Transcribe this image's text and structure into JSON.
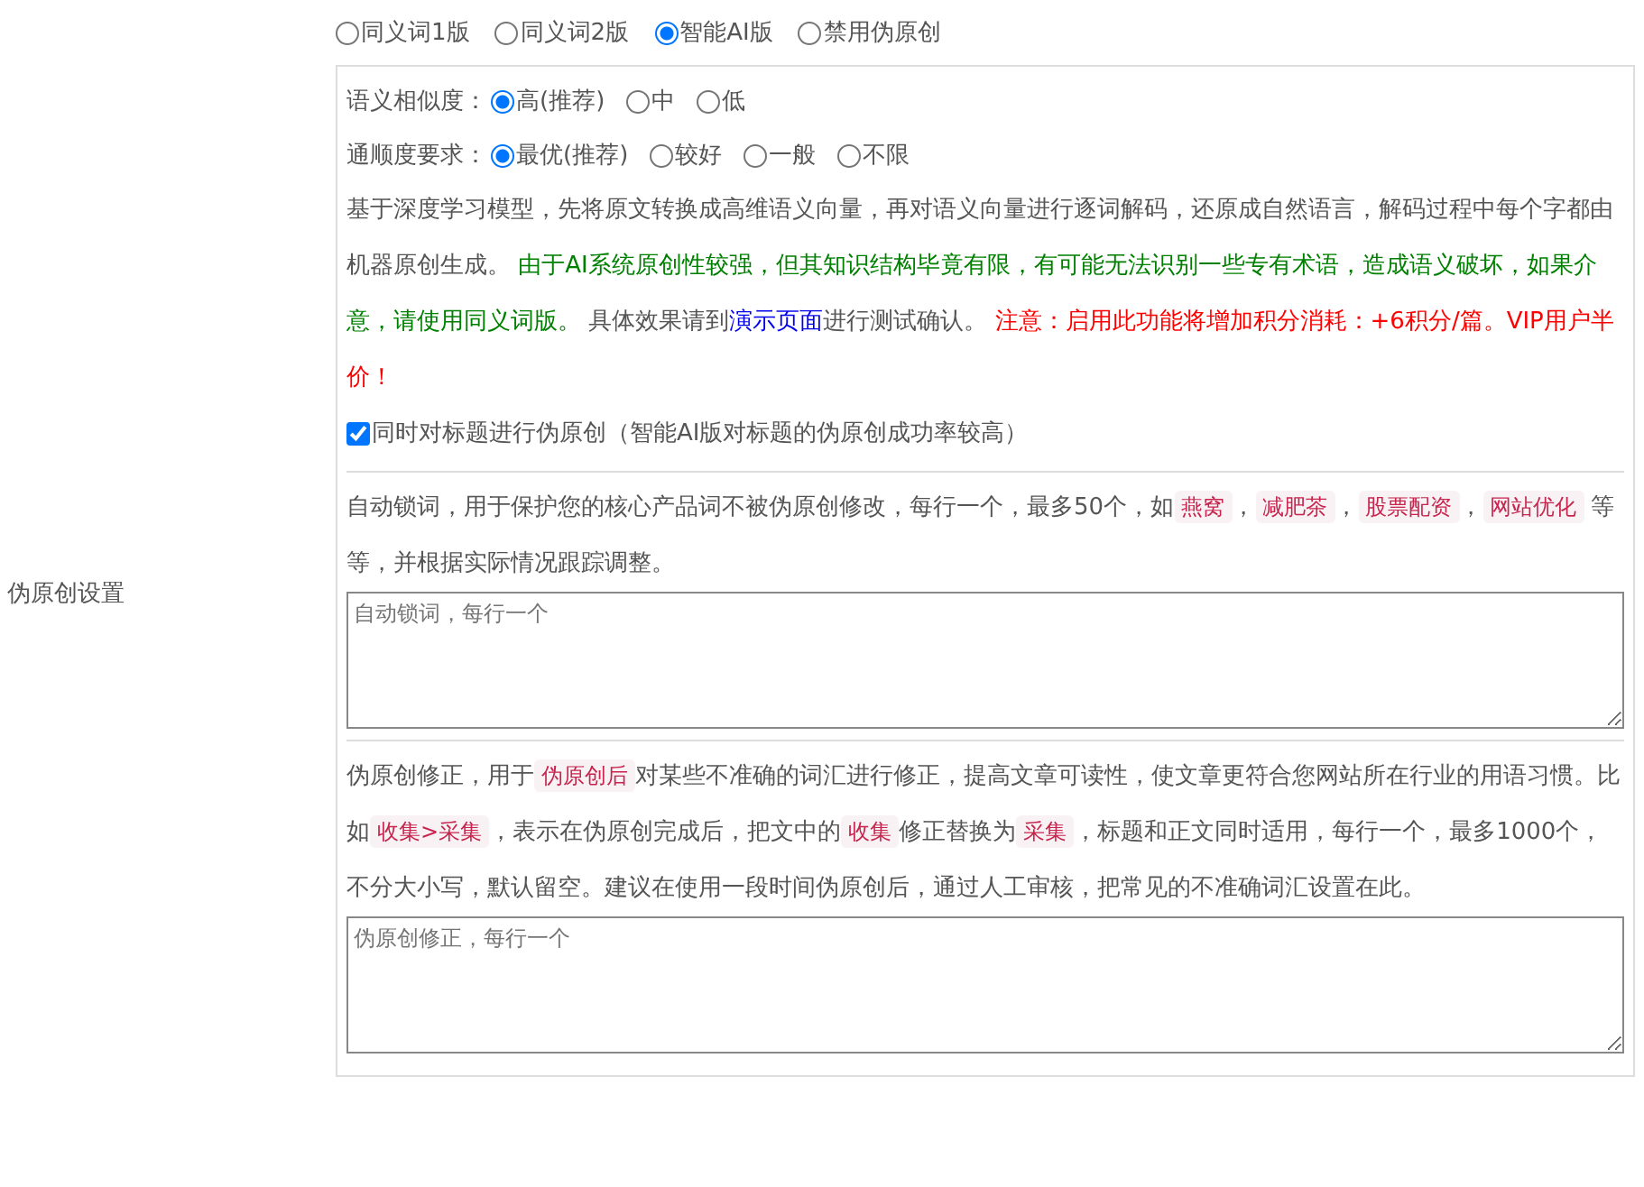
{
  "section_label": "伪原创设置",
  "modes": [
    {
      "label": "同义词1版",
      "selected": false
    },
    {
      "label": "同义词2版",
      "selected": false
    },
    {
      "label": "智能AI版",
      "selected": true
    },
    {
      "label": "禁用伪原创",
      "selected": false
    }
  ],
  "ai_panel": {
    "settings": [
      {
        "label": "语义相似度：",
        "options": [
          {
            "label": "高(推荐)",
            "selected": true
          },
          {
            "label": "中",
            "selected": false
          },
          {
            "label": "低",
            "selected": false
          }
        ]
      },
      {
        "label": "通顺度要求：",
        "options": [
          {
            "label": "最优(推荐)",
            "selected": true
          },
          {
            "label": "较好",
            "selected": false
          },
          {
            "label": "一般",
            "selected": false
          },
          {
            "label": "不限",
            "selected": false
          }
        ]
      }
    ],
    "description": [
      {
        "kind": "plain",
        "text": "基于深度学习模型，先将原文转换成高维语义向量，再对语义向量进行逐词解码，还原成自然语言，解码过程中每个字都由机器原创生成。 "
      },
      {
        "kind": "success",
        "text": "由于AI系统原创性较强，但其知识结构毕竟有限，有可能无法识别一些专有术语，造成语义破坏，如果介意，请使用同义词版。"
      },
      {
        "kind": "plain",
        "text": " 具体效果请到"
      },
      {
        "kind": "link",
        "text": "演示页面"
      },
      {
        "kind": "plain",
        "text": "进行测试确认。 "
      },
      {
        "kind": "warning",
        "text": "注意：启用此功能将增加积分消耗：+6积分/篇。VIP用户半价！"
      }
    ],
    "title_option": {
      "label": "同时对标题进行伪原创（智能AI版对标题的伪原创成功率较高）",
      "checked": true
    }
  },
  "lock_words": {
    "description": [
      {
        "kind": "plain",
        "text": "自动锁词，用于保护您的核心产品词不被伪原创修改，每行一个，最多50个，如"
      },
      {
        "kind": "code",
        "text": "燕窝"
      },
      {
        "kind": "plain",
        "text": "，"
      },
      {
        "kind": "code",
        "text": "减肥茶"
      },
      {
        "kind": "plain",
        "text": "，"
      },
      {
        "kind": "code",
        "text": "股票配资"
      },
      {
        "kind": "plain",
        "text": "，"
      },
      {
        "kind": "code",
        "text": "网站优化"
      },
      {
        "kind": "plain",
        "text": " 等等，并根据实际情况跟踪调整。"
      }
    ],
    "placeholder": "自动锁词，每行一个"
  },
  "corrections": {
    "description": [
      {
        "kind": "plain",
        "text": "伪原创修正，用于"
      },
      {
        "kind": "code",
        "text": "伪原创后"
      },
      {
        "kind": "plain",
        "text": "对某些不准确的词汇进行修正，提高文章可读性，使文章更符合您网站所在行业的用语习惯。比如"
      },
      {
        "kind": "code",
        "text": "收集>采集"
      },
      {
        "kind": "plain",
        "text": "，表示在伪原创完成后，把文中的"
      },
      {
        "kind": "code",
        "text": "收集"
      },
      {
        "kind": "plain",
        "text": "修正替换为"
      },
      {
        "kind": "code",
        "text": "采集"
      },
      {
        "kind": "plain",
        "text": "，标题和正文同时适用，每行一个，最多1000个，不分大小写，默认留空。建议在使用一段时间伪原创后，通过人工审核，把常见的不准确词汇设置在此。"
      }
    ],
    "placeholder": "伪原创修正，每行一个"
  }
}
